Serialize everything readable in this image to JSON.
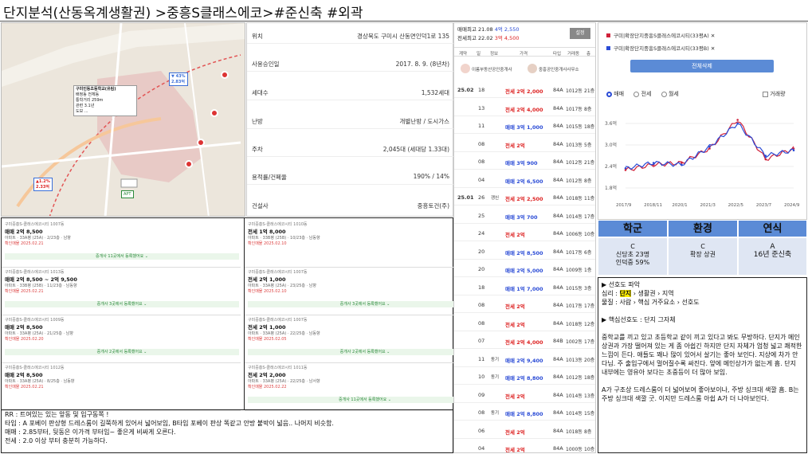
{
  "title": "단지분석(산동옥계생활권) >중흥S클래스에코>#준신축 #외곽",
  "map": {
    "school_label": "APT",
    "price_a": "2.83억",
    "price_b": "2.33억",
    "pct_a": "▼ 43%",
    "pct_b": "▲1.2%",
    "school_name": "구미인동초등학교(유림)",
    "school_lines": [
      "배정동 전체동",
      "통학거리 259m",
      "관련 3.1년",
      "도보 ..."
    ]
  },
  "info": {
    "rows": [
      [
        "위치",
        "경상북도 구미시 산동면인덕1로 135"
      ],
      [
        "사용승인일",
        "2017. 8. 9. (8년차)"
      ],
      [
        "세대수",
        "1,532세대"
      ],
      [
        "난방",
        "개별난방 / 도시가스"
      ],
      [
        "주차",
        "2,045대 (세대당 1.33대)"
      ],
      [
        "용적률/건폐율",
        "190% / 14%"
      ],
      [
        "건설사",
        "중흥토건(주)"
      ]
    ]
  },
  "tx": {
    "head": {
      "hi1": "매매최고 21.08",
      "hi1v": "4억 2,550",
      "hi2": "전세최고 22.02",
      "hi2v": "3억 4,500",
      "btn": "설정"
    },
    "cols": [
      "계약",
      "일",
      "정보",
      "가격",
      "타입",
      "거래동",
      "층"
    ],
    "agents": [
      "이룸부동산공인중개사",
      "중흥공인중개사사무소"
    ],
    "rows": [
      [
        "25.02",
        "18",
        "",
        "전세 2억 2,000",
        "84A",
        "1012동",
        "21층"
      ],
      [
        "",
        "13",
        "",
        "전세 2억 4,000",
        "84A",
        "1017동",
        "8층"
      ],
      [
        "",
        "11",
        "",
        "매매 3억 1,000",
        "84A",
        "1015동",
        "18층"
      ],
      [
        "",
        "08",
        "",
        "전세 2억",
        "84A",
        "1013동",
        "5층"
      ],
      [
        "",
        "08",
        "",
        "매매 3억 900",
        "84A",
        "1012동",
        "21층"
      ],
      [
        "",
        "04",
        "",
        "매매 2억 6,500",
        "84A",
        "1012동",
        "8층"
      ],
      [
        "25.01",
        "26",
        "갱신",
        "전세 2억 2,500",
        "84A",
        "1018동",
        "11층"
      ],
      [
        "",
        "25",
        "",
        "매매 3억 700",
        "84A",
        "1014동",
        "17층"
      ],
      [
        "",
        "24",
        "",
        "전세 2억",
        "84A",
        "1006동",
        "10층"
      ],
      [
        "",
        "20",
        "",
        "매매 2억 8,500",
        "84A",
        "1017동",
        "6층"
      ],
      [
        "",
        "20",
        "",
        "매매 2억 5,000",
        "84A",
        "1009동",
        "1층"
      ],
      [
        "",
        "18",
        "",
        "매매 1억 7,000",
        "84A",
        "1015동",
        "3층"
      ],
      [
        "",
        "08",
        "",
        "전세 2억",
        "84A",
        "1017동",
        "17층"
      ],
      [
        "",
        "08",
        "",
        "전세 2억",
        "84A",
        "1018동",
        "12층"
      ],
      [
        "",
        "07",
        "",
        "전세 2억 4,000",
        "84B",
        "1002동",
        "17층"
      ],
      [
        "",
        "11",
        "동기",
        "매매 2억 9,400",
        "84A",
        "1013동",
        "20층"
      ],
      [
        "",
        "10",
        "동기",
        "매매 2억 8,800",
        "84A",
        "1012동",
        "18층"
      ],
      [
        "",
        "09",
        "",
        "전세 2억",
        "84A",
        "1014동",
        "13층"
      ],
      [
        "",
        "08",
        "동기",
        "매매 2억 8,800",
        "84A",
        "1014동",
        "15층"
      ],
      [
        "",
        "06",
        "",
        "전세 2억",
        "84A",
        "1018동",
        "8층"
      ],
      [
        "",
        "04",
        "",
        "전세 2억",
        "84A",
        "1000동",
        "10층"
      ]
    ]
  },
  "chart": {
    "legend1": "구미|확장단지중흥S클래스에코시티(33평A) ✕",
    "legend2": "구미|확장단지중흥S클래스에코시티(33평B) ✕",
    "clear": "전체삭제",
    "radios": [
      "매매",
      "전세",
      "월세"
    ],
    "volume": "거래량",
    "yticks": [
      "3.6억",
      "3.0억",
      "2.4억",
      "1.8억"
    ],
    "xticks": [
      "2017/9",
      "2018/11",
      "2020/1",
      "2021/3",
      "2022/5",
      "2023/7",
      "2024/9"
    ],
    "colors": {
      "a": "#d0213a",
      "b": "#2a4bd6"
    }
  },
  "chart_data": {
    "type": "line",
    "x": [
      "2017/9",
      "2018/11",
      "2020/1",
      "2021/3",
      "2022/5",
      "2023/7",
      "2024/9"
    ],
    "series": [
      {
        "name": "33평A",
        "values": [
          2.3,
          2.45,
          2.5,
          2.9,
          3.7,
          2.6,
          2.9
        ]
      },
      {
        "name": "33평B",
        "values": [
          2.35,
          2.5,
          2.45,
          2.95,
          3.6,
          2.7,
          2.85
        ]
      }
    ],
    "ylim": [
      1.6,
      4.0
    ]
  },
  "grid": {
    "heads": [
      "학군",
      "환경",
      "연식"
    ],
    "cells": [
      [
        "C",
        "신당초 23명",
        "인덕중 59%"
      ],
      [
        "C",
        "확장 상권",
        ""
      ],
      [
        "A",
        "16년 준신축",
        ""
      ]
    ]
  },
  "rnotes": {
    "l1": "▶ 선호도 파악",
    "l2a": "심리 : ",
    "l2b": "단지",
    "l2c": " › 생활권 › 지역",
    "l3": "물질 : 사람 › 핵심 거주요소 › 선호도",
    "l4": "▶ 핵심선호도 : 단지 그자체",
    "l5": "중학교를 끼고 있고 초등학교 같이 끼고 있다고 봐도 무방하다. 단지가 메인 상권과 가장 떨어져 있는 게 좀 아쉽긴 하지만 단지 자체가 엄청 넓고 쾌적한 느낌이 든다. 애들도 꽤나 많이 있어서 살기는 좋아 보인다. 지상에 차가 안다님. 주 출입구에서 멀어질수록 싸진다. 앞에 메인상가가 없는게 흠. 단지 내부에는 영유아 보다는 초중등이 더 많아 보임.",
    "l6": "A가 구조상 드레스룸이 더 넓어보여 좋아보이나, 주방 싱크대 색깔 흠. B는 주방 싱크대 색깔 굿. 이지만 드레스룸 아쉽 A가 더 나아보인다."
  },
  "notes": {
    "l1": "RR : 트여있는 있는 앞동 및 입구동쪽 !",
    "l2": "타입 : A 포베이 판상형 드레스룸이 길쭉하게 있어서 넓어보임, B타입 포베이 판상 똑같고 안방 붙박이 넓음.. 나머지 비슷함.",
    "l3": "매매 : 2.85부터, 뒷동은 이가격 부터임~ 좋은게 비싸게 오른다.",
    "l4": "전세 : 2.0 이상 부터 충분히 가능하다."
  },
  "lists": {
    "left": [
      {
        "h": "구미중흥S-클래스에코시티 1007동",
        "p": "매매 2억 8,500",
        "d": "아파트 · 33A평 (25A) · 2/23층 · 남향",
        "r": "확인매물 2025.02.21",
        "bar": "중개사 11곳에서 등록했어요 ⌄"
      },
      {
        "h": "구미중흥S-클래스에코시티 1013동",
        "p": "매매 2억 8,500 ~ 2억 9,500",
        "d": "아파트 · 33B평 (25B) · 11/23층 · 남동향",
        "r": "확인매물 2025.02.21",
        "bar": "중개사 3곳에서 등록했어요 ⌄"
      },
      {
        "h": "구미중흥S-클래스에코시티 1009동",
        "p": "매매 2억 8,500",
        "d": "아파트 · 33A평 (25A) · 21/25층 · 남향",
        "r": "확인매물 2025.02.20",
        "bar": "중개사 2곳에서 등록했어요 ⌄"
      },
      {
        "h": "구미중흥S-클래스에코시티 1012동",
        "p": "매매 2억 8,500",
        "d": "아파트 · 33A평 (25A) · 8/25층 · 남동향",
        "r": "확인매물 2025.02.21",
        "bar": ""
      }
    ],
    "right": [
      {
        "h": "구미중흥S-클래스에코시티 1010동",
        "p": "전세 1억 8,000",
        "d": "아파트 · 33B평 (25B) · 10/23층 · 남동향",
        "r": "확인매물 2025.02.10",
        "bar": ""
      },
      {
        "h": "구미중흥S-클래스에코시티 1007동",
        "p": "전세 2억 1,000",
        "d": "아파트 · 33A평 (25A) · 23/25층 · 남향",
        "r": "확인매물 2025.02.10",
        "bar": "중개사 3곳에서 등록했어요 ⌄"
      },
      {
        "h": "구미중흥S-클래스에코시티 1007동",
        "p": "전세 2억 1,000",
        "d": "아파트 · 33A평 (25A) · 22/25층 · 남동향",
        "r": "확인매물 2025.02.05",
        "bar": "중개사 2곳에서 등록했어요 ⌄"
      },
      {
        "h": "구미중흥S-클래스에코시티 1011동",
        "p": "전세 2억 2,000",
        "d": "아파트 · 33A평 (25A) · 22/25층 · 남서향",
        "r": "확인매물 2025.02.22",
        "bar": "중개사 11곳에서 등록했어요 ⌄"
      }
    ]
  }
}
